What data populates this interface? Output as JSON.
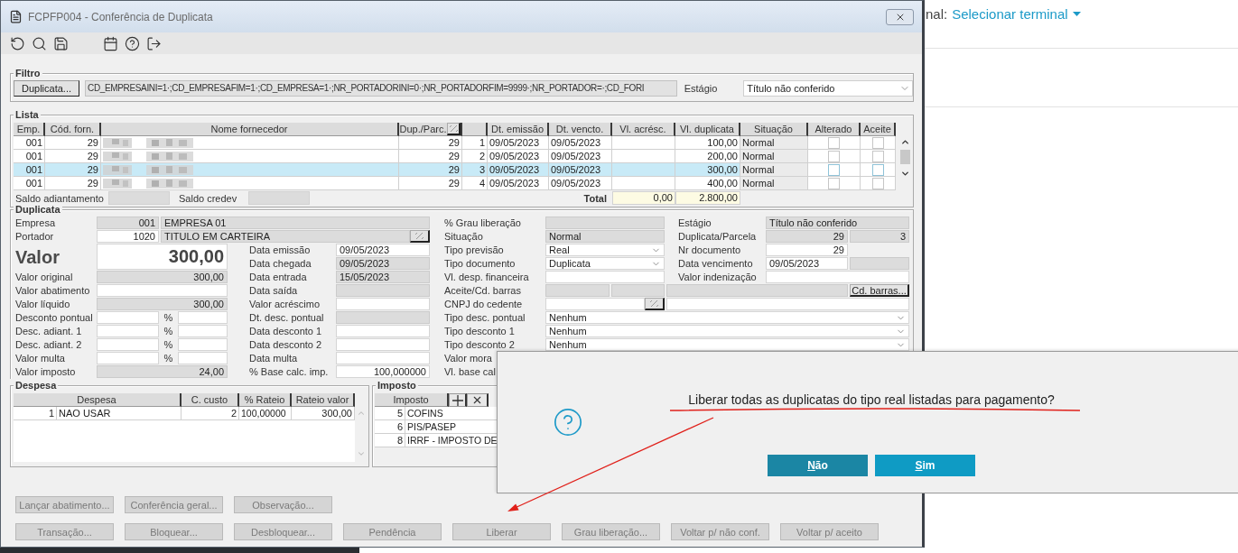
{
  "window": {
    "title": "FCPFP004 - Conferência de Duplicata"
  },
  "web_header": {
    "terminal_label": "nal:",
    "terminal_link": "Selecionar terminal"
  },
  "filter": {
    "legend": "Filtro",
    "button": "Duplicata...",
    "expression": "CD_EMPRESAINI=1·;CD_EMPRESAFIM=1·;CD_EMPRESA=1·;NR_PORTADORINI=0·;NR_PORTADORFIM=9999·;NR_PORTADOR=·;CD_FORI",
    "stage_label": "Estágio",
    "stage_value": "Título não conferido"
  },
  "list": {
    "legend": "Lista",
    "columns": [
      {
        "label": "Emp.",
        "kind": "text"
      },
      {
        "label": "Cód. forn.",
        "kind": "text"
      },
      {
        "label": "Nome fornecedor",
        "kind": "text"
      },
      {
        "label": "Dup./Parc.",
        "kind": "lookup"
      },
      {
        "kind": "blank"
      },
      {
        "label": "Dt. emissão",
        "kind": "text"
      },
      {
        "label": "Dt. vencto.",
        "kind": "text"
      },
      {
        "label": "Vl. acrésc.",
        "kind": "text"
      },
      {
        "label": "Vl. duplicata",
        "kind": "text"
      },
      {
        "label": "Situação",
        "kind": "text"
      },
      {
        "label": "Alterado",
        "kind": "text"
      },
      {
        "label": "Aceite",
        "kind": "text"
      }
    ],
    "rows": [
      {
        "emp": "001",
        "supplier": "29",
        "dup": "29",
        "parcel": "1",
        "issued": "09/05/2023",
        "due": "09/05/2023",
        "amount": "100,00",
        "status": "Normal",
        "altered": false,
        "accepted": false,
        "selected": false
      },
      {
        "emp": "001",
        "supplier": "29",
        "dup": "29",
        "parcel": "2",
        "issued": "09/05/2023",
        "due": "09/05/2023",
        "amount": "200,00",
        "status": "Normal",
        "altered": false,
        "accepted": false,
        "selected": false
      },
      {
        "emp": "001",
        "supplier": "29",
        "dup": "29",
        "parcel": "3",
        "issued": "09/05/2023",
        "due": "09/05/2023",
        "amount": "300,00",
        "status": "Normal",
        "altered": false,
        "accepted": false,
        "selected": true
      },
      {
        "emp": "001",
        "supplier": "29",
        "dup": "29",
        "parcel": "4",
        "issued": "09/05/2023",
        "due": "09/05/2023",
        "amount": "400,00",
        "status": "Normal",
        "altered": false,
        "accepted": false,
        "selected": false
      }
    ],
    "totals": {
      "advance_label": "Saldo adiantamento",
      "credev_label": "Saldo credev",
      "total_label": "Total",
      "surcharge": "0,00",
      "amount": "2.800,00"
    }
  },
  "duplicata": {
    "legend": "Duplicata",
    "fields": [
      {
        "label": "Empresa",
        "inputs": [
          {
            "kind": "text",
            "value": "001",
            "readonly": true
          },
          {
            "kind": "text",
            "value": "EMPRESA 01",
            "readonly": true
          }
        ]
      },
      {
        "label": "Portador",
        "inputs": [
          {
            "kind": "text",
            "value": "1020",
            "readonly": false
          },
          {
            "kind": "text",
            "value": "TITULO EM CARTEIRA",
            "readonly": true
          },
          {
            "kind": "lookup"
          }
        ]
      },
      {
        "label": "Valor",
        "inputs": [
          {
            "kind": "text",
            "value": "300,00",
            "readonly": false
          }
        ]
      },
      {
        "label": "Valor original",
        "inputs": [
          {
            "kind": "text",
            "value": "300,00",
            "readonly": true
          }
        ]
      },
      {
        "label": "Valor abatimento",
        "inputs": [
          {
            "kind": "text",
            "readonly": false
          }
        ]
      },
      {
        "label": "Valor líquido",
        "inputs": [
          {
            "kind": "text",
            "value": "300,00",
            "readonly": true
          }
        ]
      },
      {
        "label": "Desconto pontual",
        "inputs": [
          {
            "kind": "text",
            "readonly": false
          },
          {
            "kind": "unit",
            "value": "%"
          },
          {
            "kind": "text",
            "readonly": false
          }
        ]
      },
      {
        "label": "Desc. adiant. 1",
        "inputs": [
          {
            "kind": "text",
            "readonly": false
          },
          {
            "kind": "unit",
            "value": "%"
          },
          {
            "kind": "text",
            "readonly": false
          }
        ]
      },
      {
        "label": "Desc. adiant. 2",
        "inputs": [
          {
            "kind": "text",
            "readonly": false
          },
          {
            "kind": "unit",
            "value": "%"
          },
          {
            "kind": "text",
            "readonly": false
          }
        ]
      },
      {
        "label": "Valor multa",
        "inputs": [
          {
            "kind": "text",
            "readonly": false
          },
          {
            "kind": "unit",
            "value": "%"
          },
          {
            "kind": "text",
            "readonly": false
          }
        ]
      },
      {
        "label": "Valor imposto",
        "inputs": [
          {
            "kind": "text",
            "value": "24,00",
            "readonly": true
          }
        ]
      },
      {
        "label": "Data emissão",
        "inputs": [
          {
            "kind": "text",
            "value": "09/05/2023",
            "readonly": false
          }
        ]
      },
      {
        "label": "Data chegada",
        "inputs": [
          {
            "kind": "text",
            "value": "09/05/2023",
            "readonly": true
          }
        ]
      },
      {
        "label": "Data entrada",
        "inputs": [
          {
            "kind": "text",
            "value": "15/05/2023",
            "readonly": true
          }
        ]
      },
      {
        "label": "Data saída",
        "inputs": [
          {
            "kind": "text",
            "readonly": true
          }
        ]
      },
      {
        "label": "Valor acréscimo",
        "inputs": [
          {
            "kind": "text",
            "readonly": false
          }
        ]
      },
      {
        "label": "Dt. desc. pontual",
        "inputs": [
          {
            "kind": "text",
            "readonly": true
          }
        ]
      },
      {
        "label": "Data desconto 1",
        "inputs": [
          {
            "kind": "text",
            "readonly": false
          }
        ]
      },
      {
        "label": "Data desconto 2",
        "inputs": [
          {
            "kind": "text",
            "readonly": false
          }
        ]
      },
      {
        "label": "Data multa",
        "inputs": [
          {
            "kind": "text",
            "readonly": false
          }
        ]
      },
      {
        "label": "% Base calc. imp.",
        "inputs": [
          {
            "kind": "text",
            "value": "100,000000",
            "readonly": false
          }
        ]
      },
      {
        "label": "% Grau liberação",
        "inputs": [
          {
            "kind": "text",
            "readonly": true
          }
        ]
      },
      {
        "label": "Situação",
        "inputs": [
          {
            "kind": "text",
            "value": "Normal",
            "readonly": true
          }
        ]
      },
      {
        "label": "Tipo previsão",
        "inputs": [
          {
            "kind": "select",
            "value": "Real"
          }
        ]
      },
      {
        "label": "Tipo documento",
        "inputs": [
          {
            "kind": "select",
            "value": "Duplicata"
          }
        ]
      },
      {
        "label": "Vl. desp. financeira",
        "inputs": [
          {
            "kind": "text",
            "readonly": false
          }
        ]
      },
      {
        "label": "Aceite/Cd. barras",
        "inputs": [
          {
            "kind": "text",
            "readonly": true
          },
          {
            "kind": "text",
            "readonly": true
          },
          {
            "kind": "text",
            "readonly": true
          },
          {
            "kind": "button",
            "value": "Cd. barras..."
          }
        ]
      },
      {
        "label": "CNPJ do cedente",
        "inputs": [
          {
            "kind": "text",
            "readonly": false
          },
          {
            "kind": "lookup"
          },
          {
            "kind": "text",
            "readonly": false
          }
        ]
      },
      {
        "label": "Tipo desc. pontual",
        "inputs": [
          {
            "kind": "select",
            "value": "Nenhum"
          }
        ]
      },
      {
        "label": "Tipo desconto 1",
        "inputs": [
          {
            "kind": "select",
            "value": "Nenhum"
          }
        ]
      },
      {
        "label": "Tipo desconto 2",
        "inputs": [
          {
            "kind": "select",
            "value": "Nenhum"
          }
        ]
      },
      {
        "label": "Valor mora"
      },
      {
        "label": "Vl. base cal"
      },
      {
        "label": "Estágio",
        "inputs": [
          {
            "kind": "text",
            "value": "Título não conferido",
            "readonly": true
          }
        ]
      },
      {
        "label": "Duplicata/Parcela",
        "inputs": [
          {
            "kind": "text",
            "value": "29",
            "readonly": true
          },
          {
            "kind": "text",
            "value": "3",
            "readonly": true
          }
        ]
      },
      {
        "label": "Nr documento",
        "inputs": [
          {
            "kind": "text",
            "value": "29",
            "readonly": false
          }
        ]
      },
      {
        "label": "Data vencimento",
        "inputs": [
          {
            "kind": "text",
            "value": "09/05/2023",
            "readonly": false
          },
          {
            "kind": "text",
            "readonly": true
          }
        ]
      },
      {
        "label": "Valor indenização",
        "inputs": [
          {
            "kind": "text",
            "readonly": false
          }
        ]
      }
    ]
  },
  "despesa": {
    "legend": "Despesa",
    "columns": [
      "Despesa",
      "C. custo",
      "% Rateio",
      "Rateio valor"
    ],
    "rows": [
      {
        "seq": "1",
        "name": "NAO USAR",
        "cost_center": "2",
        "percent": "100,00000",
        "value": "300,00"
      }
    ]
  },
  "imposto": {
    "legend": "Imposto",
    "column": "Imposto",
    "rows": [
      {
        "code": "5",
        "name": "COFINS"
      },
      {
        "code": "6",
        "name": "PIS/PASEP"
      },
      {
        "code": "8",
        "name": "IRRF - IMPOSTO DE"
      }
    ]
  },
  "actions": [
    [
      {
        "label": "Lançar abatimento...",
        "disabled": true
      },
      {
        "label": "Conferência geral...",
        "disabled": true
      },
      {
        "label": "Observação...",
        "disabled": true
      }
    ],
    [
      {
        "label": "Transação...",
        "disabled": true
      },
      {
        "label": "Bloquear...",
        "disabled": true
      },
      {
        "label": "Desbloquear...",
        "disabled": true
      },
      {
        "label": "Pendência",
        "disabled": true
      },
      {
        "label": "Liberar",
        "disabled": true
      },
      {
        "label": "Grau liberação...",
        "disabled": true
      },
      {
        "label": "Voltar p/ não conf.",
        "disabled": true
      },
      {
        "label": "Voltar p/ aceito",
        "disabled": true
      }
    ]
  ],
  "dialog": {
    "message": "Liberar todas as duplicatas do tipo real listadas para pagamento?",
    "buttons": [
      {
        "label": "Não",
        "selected": true
      },
      {
        "label": "Sim",
        "selected": false
      }
    ]
  }
}
